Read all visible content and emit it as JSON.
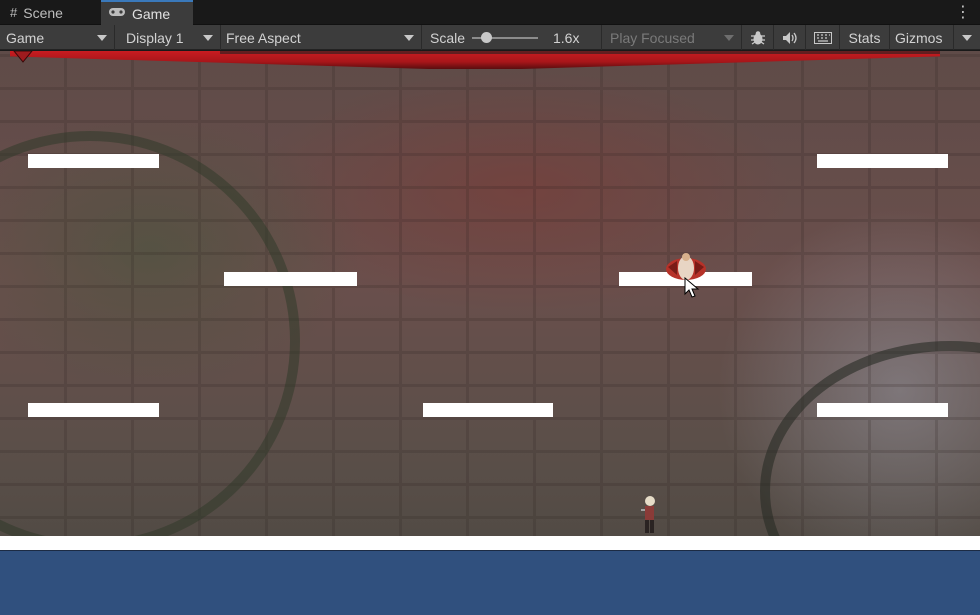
{
  "tabs": [
    {
      "label": "Scene",
      "icon": "grid-icon"
    },
    {
      "label": "Game",
      "icon": "gamepad-icon",
      "active": true
    }
  ],
  "toolbar": {
    "display_mode": "Game",
    "display": "Display 1",
    "aspect": "Free Aspect",
    "scale_label": "Scale",
    "scale_value": "1.6x",
    "scale_fraction": 0.15,
    "play_mode": "Play Focused",
    "stats_label": "Stats",
    "gizmos_label": "Gizmos"
  },
  "game": {
    "colors": {
      "platform": "#ffffff",
      "water": "#30507e",
      "health_bar": "#c81c21"
    }
  }
}
